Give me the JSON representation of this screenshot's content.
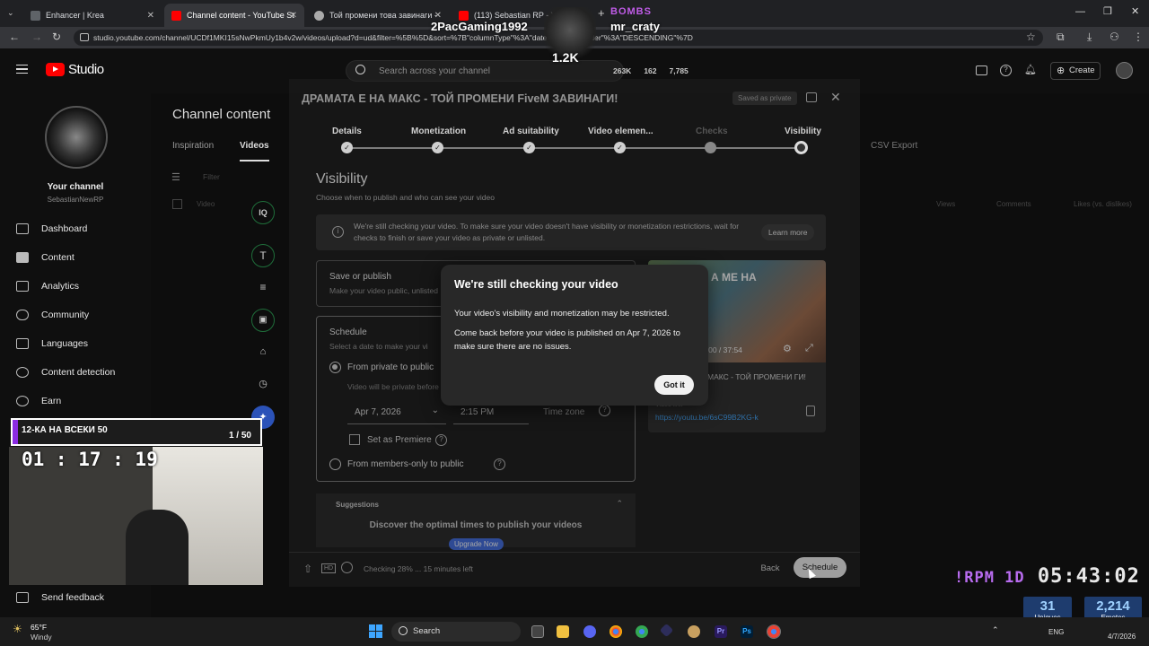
{
  "browser": {
    "tabs": [
      {
        "label": "Enhancer | Krea",
        "color": "#5f6368"
      },
      {
        "label": "Channel content - YouTube Stu",
        "color": "#ff0000"
      },
      {
        "label": "Той промени това завинаги - ",
        "color": "#aaaaaa"
      },
      {
        "label": "(113) Sebastian RP - YouTube",
        "color": "#ff0000"
      }
    ],
    "url": "studio.youtube.com/channel/UCDf1MKI15sNwPkmUy1b4v2w/videos/upload?d=ud&filter=%5B%5D&sort=%7B\"columnType\"%3A\"date\"%2C\"sortOrder\"%3A\"DESCENDING\"%7D"
  },
  "overlay_stream": {
    "follower_name": "2PacGaming1992",
    "bombs_label": "BOMBS",
    "bomber_name": "mr_craty",
    "bombs_count": "1.2K",
    "rpm_label": "!RPM 1D",
    "rpm_time": "05:43:02",
    "uniques_value": "31",
    "uniques_label": "Uniques",
    "emotes_value": "2,214",
    "emotes_label": "Emotes",
    "counter_title": "12-КА НА ВСЕКИ 50",
    "counter_value": "1 / 50",
    "timer": "01 : 17 : 19"
  },
  "studio": {
    "logo": "Studio",
    "search_placeholder": "Search across your channel",
    "stats": [
      "263K",
      "162",
      "7,785"
    ],
    "create_label": "Create",
    "channel_heading": "Your channel",
    "channel_name": "SebastianNewRP",
    "nav": [
      "Dashboard",
      "Content",
      "Analytics",
      "Community",
      "Languages",
      "Content detection",
      "Earn"
    ],
    "send_feedback": "Send feedback",
    "page_title": "Channel content",
    "page_tabs": [
      "Inspiration",
      "Videos"
    ],
    "csv_export": "CSV Export",
    "table_cols": [
      "Video",
      "Views",
      "Comments",
      "Likes (vs. dislikes)"
    ],
    "filter_label": "Filter"
  },
  "upload": {
    "title": "ДРАМАТА Е НА МАКС - ТОЙ ПРОМЕНИ FiveM ЗАВИНАГИ!",
    "saved_badge": "Saved as private",
    "steps": [
      "Details",
      "Monetization",
      "Ad suitability",
      "Video elemen...",
      "Checks",
      "Visibility"
    ],
    "visibility_heading": "Visibility",
    "visibility_sub": "Choose when to publish and who can see your video",
    "info_text": "We're still checking your video. To make sure your video doesn't have visibility or monetization restrictions, wait for checks to finish or save your video as private or unlisted.",
    "learn_more": "Learn more",
    "save_publish": "Save or publish",
    "save_publish_sub": "Make your video public, unlisted",
    "schedule": "Schedule",
    "schedule_sub": "Select a date to make your vi",
    "from_private": "From private to public",
    "will_be_private": "Video will be private before",
    "date": "Apr 7, 2026",
    "time": "2:15 PM",
    "time_zone": "Time zone",
    "premiere": "Set as Premiere",
    "members_only": "From members-only to public",
    "suggestions": "Suggestions",
    "discover": "Discover the optimal times to publish your videos",
    "upgrade": "Upgrade Now",
    "video_time": "0:00 / 37:54",
    "video_title_short": "МАКС - ТОЙ ПРОМЕНИ ГИ!",
    "video_link_label": "Video link",
    "video_link": "https://youtu.be/6sC99B2KG-k",
    "thumb_text": "А МЕ НА",
    "checking": "Checking 28% ... 15 minutes left",
    "back": "Back",
    "schedule_btn": "Schedule"
  },
  "modal": {
    "title": "We're still checking your video",
    "line1": "Your video's visibility and monetization may be restricted.",
    "line2": "Come back before your video is published on Apr 7, 2026 to make sure there are no issues.",
    "button": "Got it"
  },
  "taskbar": {
    "weather_temp": "65°F",
    "weather_desc": "Windy",
    "search": "Search",
    "lang": "ENG",
    "date": "4/7/2026"
  }
}
